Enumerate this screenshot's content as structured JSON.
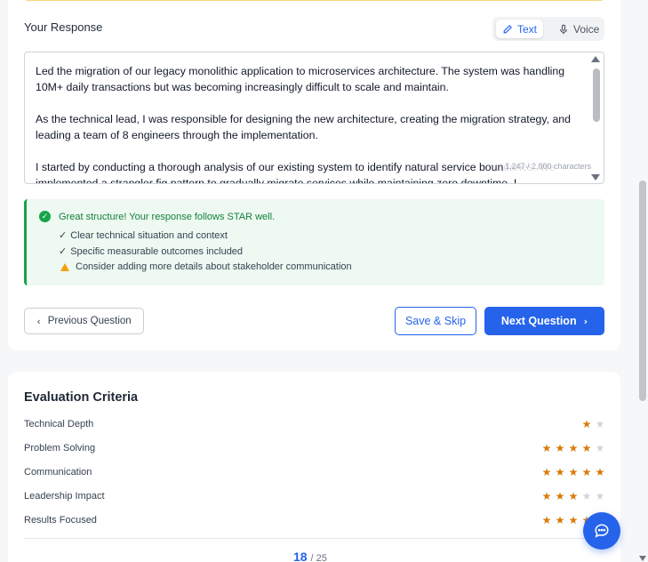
{
  "response": {
    "title": "Your Response",
    "mode_text": "Text",
    "mode_voice": "Voice",
    "paragraphs": [
      "Led the migration of our legacy monolithic application to microservices architecture. The system was handling 10M+ daily transactions but was becoming increasingly difficult to scale and maintain.",
      "As the technical lead, I was responsible for designing the new architecture, creating the migration strategy, and leading a team of 8 engineers through the implementation.",
      "I started by conducting a thorough analysis of our existing system to identify natural service boundaries. We implemented a strangler fig pattern to gradually migrate services while maintaining zero downtime. I"
    ],
    "char_count": "1,247 / 2,000 characters"
  },
  "feedback": {
    "headline": "Great structure! Your response follows STAR well.",
    "items": [
      {
        "mark": "✓",
        "text": "Clear technical situation and context"
      },
      {
        "mark": "✓",
        "text": "Specific measurable outcomes included"
      },
      {
        "mark": "warning",
        "text": "Consider adding more details about stakeholder communication"
      }
    ]
  },
  "buttons": {
    "previous": "Previous Question",
    "save_skip": "Save & Skip",
    "next": "Next Question"
  },
  "evaluation": {
    "title": "Evaluation Criteria",
    "criteria": [
      {
        "label": "Technical Depth",
        "rating": 1,
        "max": 2
      },
      {
        "label": "Problem Solving",
        "rating": 4,
        "max": 5
      },
      {
        "label": "Communication",
        "rating": 5,
        "max": 5
      },
      {
        "label": "Leadership Impact",
        "rating": 3,
        "max": 5
      },
      {
        "label": "Results Focused",
        "rating": 4,
        "max": 5
      }
    ],
    "current": "18",
    "total": "/ 25"
  },
  "colors": {
    "accent": "#2563eb",
    "success": "#16a34a",
    "star": "#d97706",
    "warning": "#f59e0b"
  },
  "icons": {
    "text_mode": "pencil-icon",
    "voice_mode": "microphone-icon",
    "feedback": "check-circle-icon",
    "warning": "warning-icon",
    "prev": "chevron-left-icon",
    "next": "chevron-right-icon",
    "chat": "chat-bubble-icon"
  }
}
